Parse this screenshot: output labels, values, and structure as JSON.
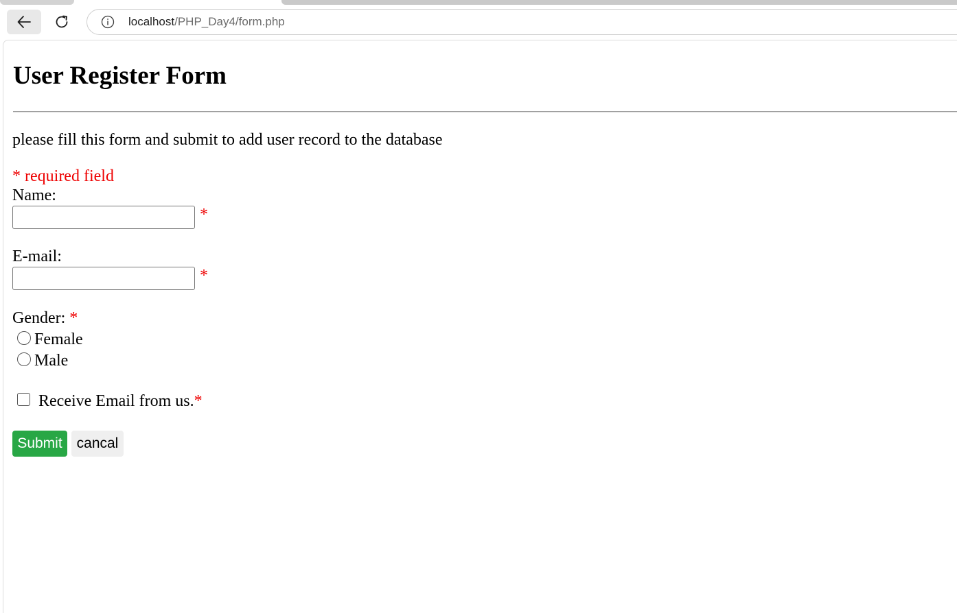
{
  "browser": {
    "url_host": "localhost",
    "url_path": "/PHP_Day4/form.php",
    "icons": {
      "back": "arrow-left-icon",
      "reload": "reload-icon",
      "site_info": "info-icon"
    }
  },
  "page": {
    "title": "User Register Form",
    "intro": "please fill this form and submit to add user record to the database",
    "required_note": "* required field",
    "required_star": "*",
    "accent_required_color": "#ee0000"
  },
  "form": {
    "name_label": "Name:",
    "name_value": "",
    "email_label": "E-mail:",
    "email_value": "",
    "gender_label": "Gender:",
    "gender_options": [
      "Female",
      "Male"
    ],
    "gender_selected": null,
    "receive_email_label": "Receive Email from us.",
    "receive_email_checked": false,
    "submit_label": "Submit",
    "submit_color": "#28a745",
    "cancel_label": "cancal"
  }
}
